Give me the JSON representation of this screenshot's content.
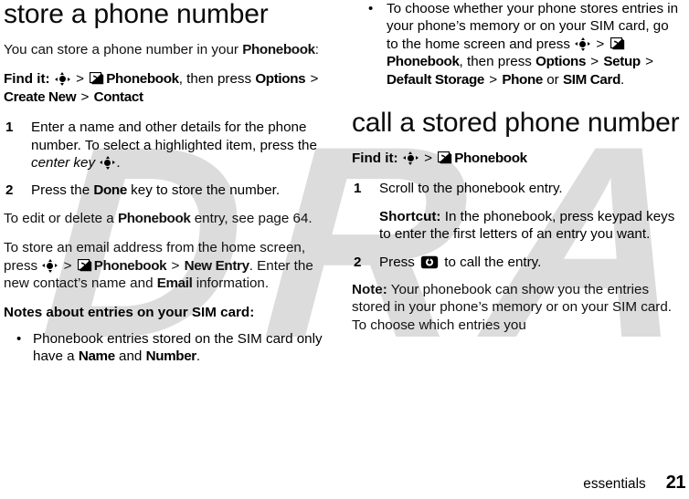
{
  "document": {
    "footer": {
      "chapter": "essentials",
      "page_number": "21"
    },
    "watermark": {
      "text": "DRAFT",
      "color": "#dcdcdc"
    }
  },
  "icons": {
    "center_key": "center-key-icon",
    "phonebook": "phonebook-icon",
    "call_key": "call-key-icon"
  },
  "left_column": {
    "title": "store a phone number",
    "intro": {
      "lead": "You can store a phone number in your ",
      "bold_term": "Phonebook",
      "tail": ":"
    },
    "find_it": {
      "label": "Find it:",
      "sep1": ">",
      "phonebook": "Phonebook",
      "after_phonebook": ", then press ",
      "options": "Options",
      "sep2": ">",
      "create_new": "Create New",
      "sep3": ">",
      "contact": "Contact"
    },
    "steps": [
      {
        "num": "1",
        "t1": "Enter a name and other details for the phone number. To select a highlighted item, press the ",
        "italic": "center key",
        "t2": "."
      },
      {
        "num": "2",
        "t1": "Press the ",
        "bold": "Done",
        "t2": " key to store the number."
      }
    ],
    "edit_note": {
      "t1": "To edit or delete a ",
      "bold": "Phonebook",
      "t2": " entry, see page 64."
    },
    "email_note": {
      "t1": "To store an email address from the home screen, press ",
      "sep1": ">",
      "phonebook": "Phonebook",
      "sep2": ">",
      "new_entry": "New Entry",
      "t2": ". Enter the new contact’s name and ",
      "email": "Email",
      "t3": " information."
    },
    "notes_heading": "Notes about entries on your SIM card:",
    "bullets": [
      {
        "t1": "Phonebook entries stored on the SIM card only have a ",
        "b1": "Name",
        "t2": " and ",
        "b2": "Number",
        "t3": "."
      }
    ]
  },
  "right_column": {
    "bullets": [
      {
        "t1": "To choose whether your phone stores entries in your phone’s memory or on your SIM card, go to the home screen and press ",
        "sep1": ">",
        "phonebook": "Phonebook",
        "t2": ", then press ",
        "options": "Options",
        "sep2": ">",
        "setup": "Setup",
        "sep3": ">",
        "default_storage": "Default Storage",
        "sep4": ">",
        "phone": "Phone",
        "t3": " or ",
        "sim_card": "SIM Card",
        "t4": "."
      }
    ],
    "title": "call a stored phone number",
    "find_it": {
      "label": "Find it:",
      "sep1": ">",
      "phonebook": "Phonebook"
    },
    "steps": [
      {
        "num": "1",
        "t1": "Scroll to the phonebook entry.",
        "sub_bold": "Shortcut:",
        "sub_text": " In the phonebook, press keypad keys to enter the first letters of an entry you want."
      },
      {
        "num": "2",
        "t1": "Press ",
        "t2": " to call the entry."
      }
    ],
    "note": {
      "bold": "Note:",
      "text": " Your phonebook can show you the entries stored in your phone’s memory or on your SIM card. To choose which entries you"
    }
  }
}
